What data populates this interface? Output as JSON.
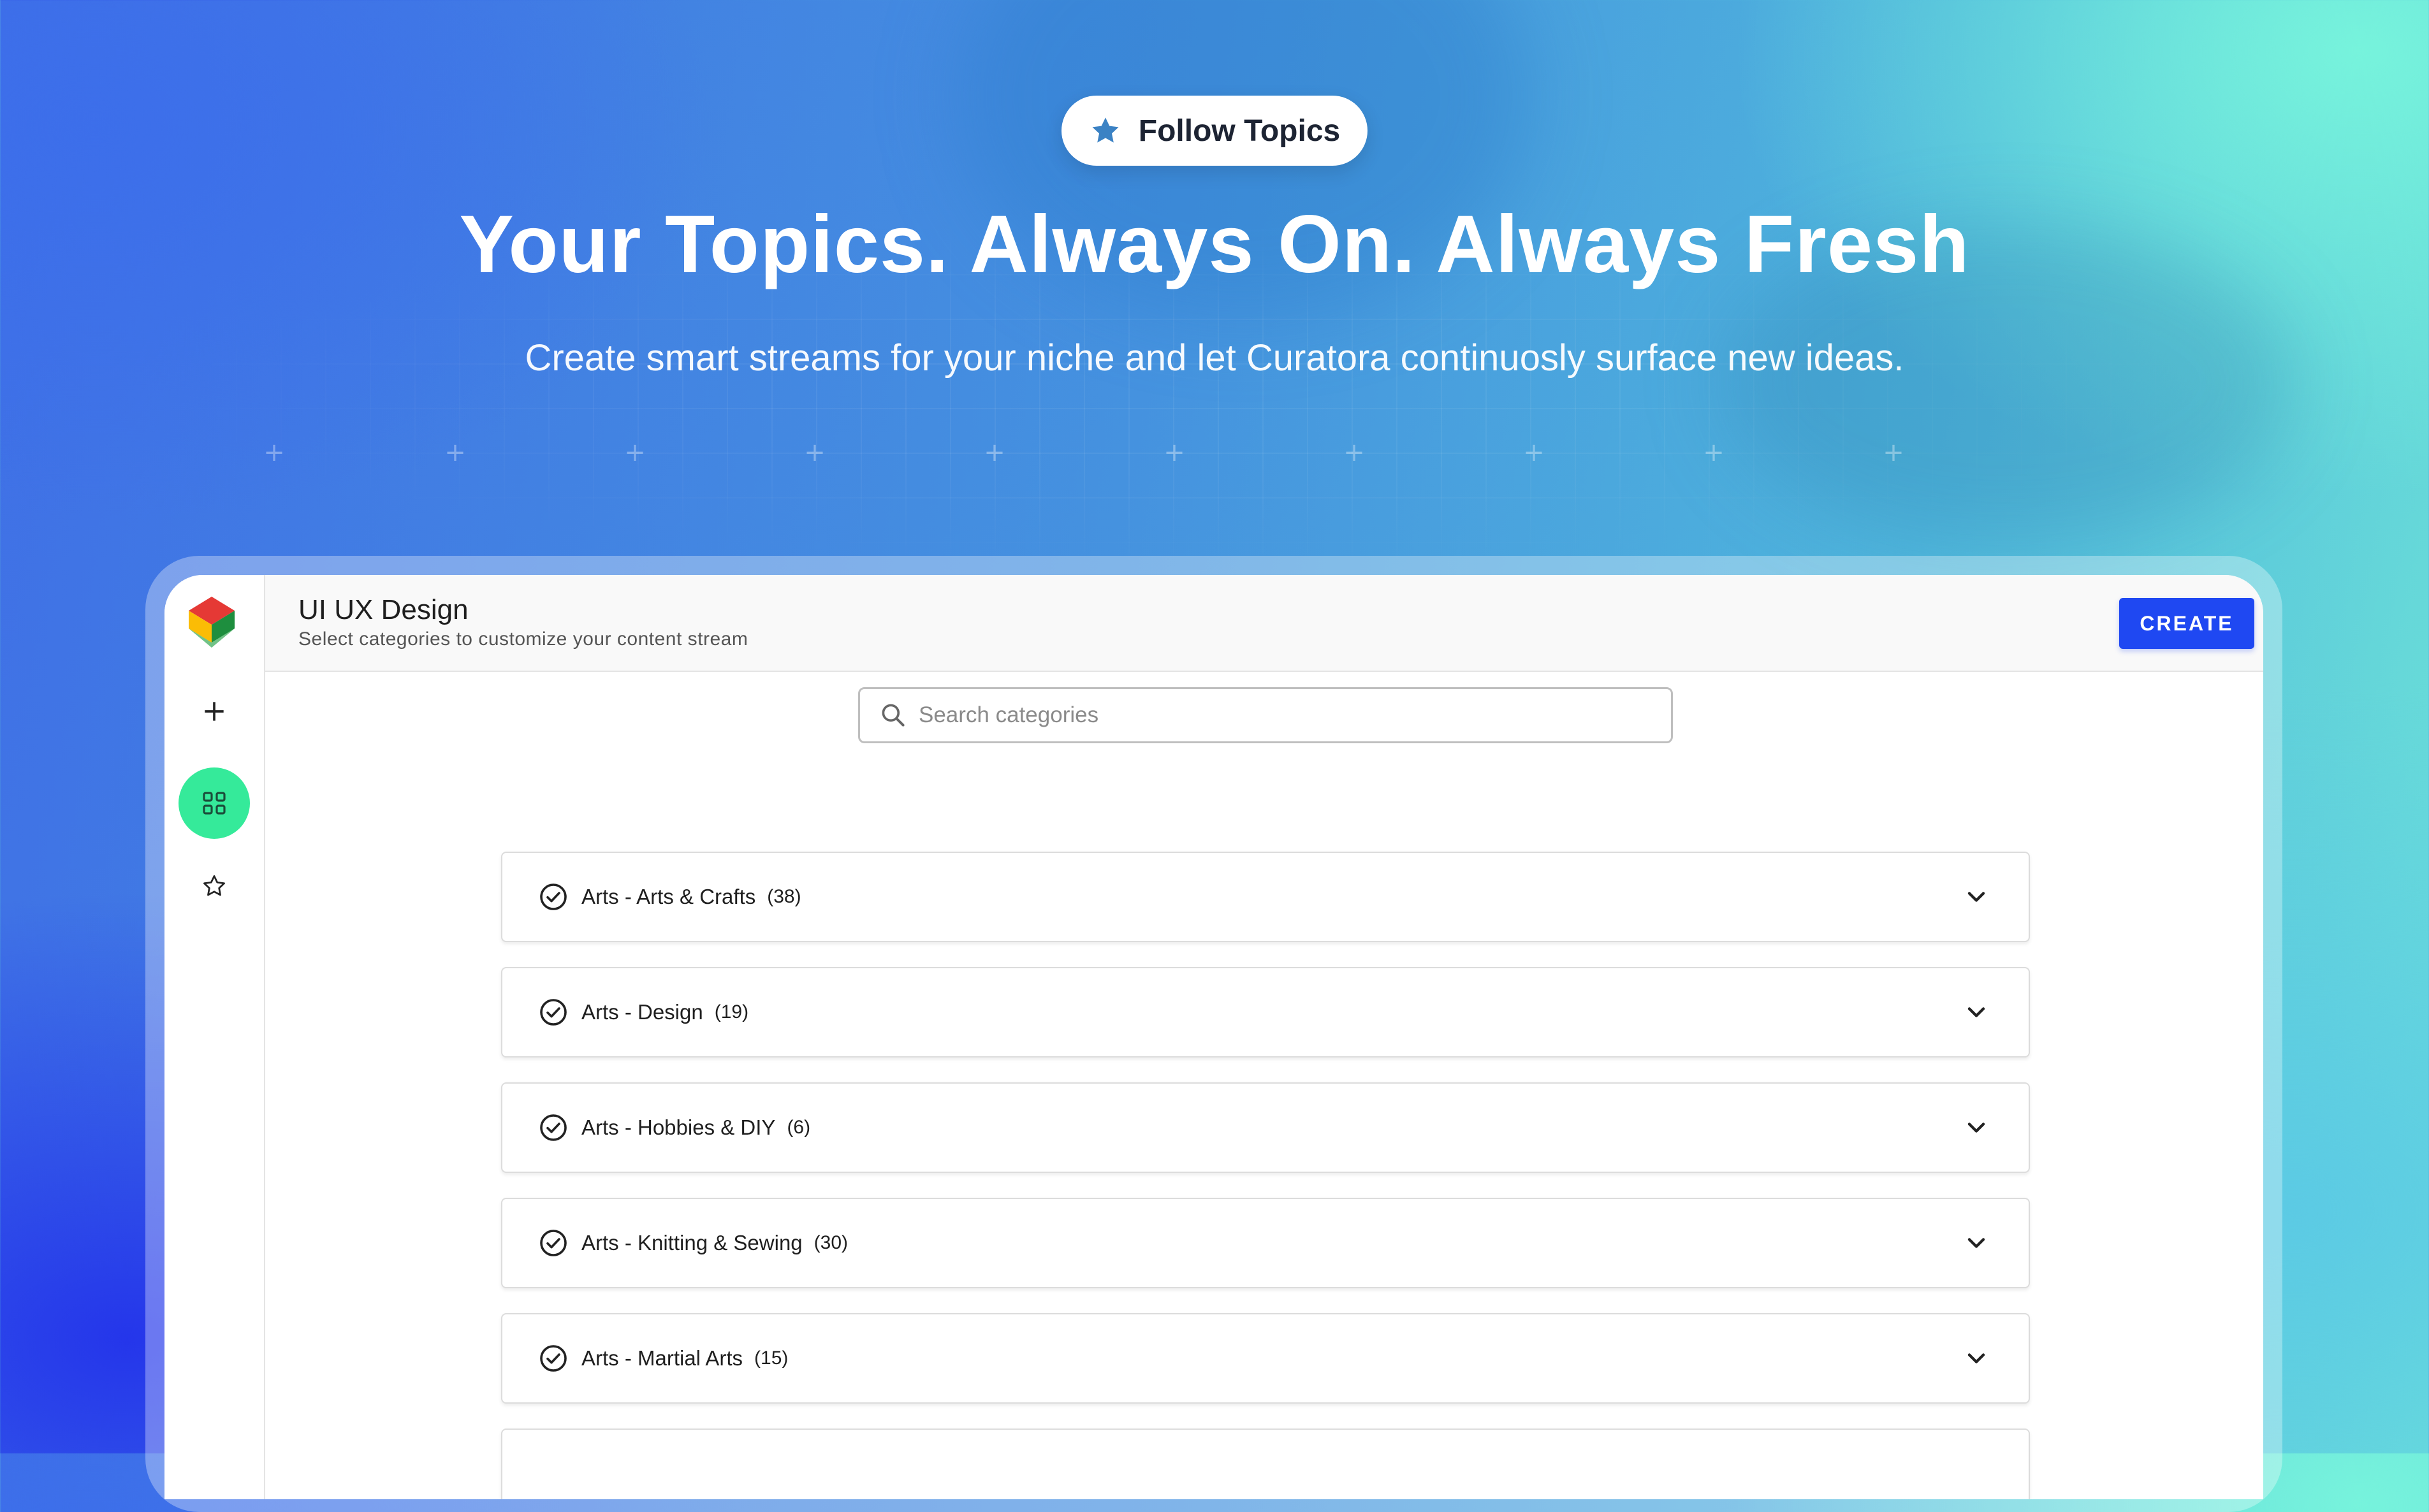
{
  "hero": {
    "pill_label": "Follow Topics",
    "title": "Your Topics. Always On. Always Fresh",
    "subtitle": "Create smart streams for your niche and let Curatora continuosly surface new ideas."
  },
  "app": {
    "sidebar": {
      "items": [
        {
          "name": "add",
          "icon": "plus-icon"
        },
        {
          "name": "categories",
          "icon": "grid-icon",
          "active": true
        },
        {
          "name": "favorites",
          "icon": "star-icon"
        }
      ]
    },
    "header": {
      "title": "UI UX Design",
      "subtitle": "Select categories to customize your content stream",
      "create_label": "CREATE"
    },
    "search": {
      "placeholder": "Search categories"
    },
    "categories": [
      {
        "name": "Arts - Arts & Crafts",
        "count": "(38)"
      },
      {
        "name": "Arts - Design",
        "count": "(19)"
      },
      {
        "name": "Arts - Hobbies & DIY",
        "count": "(6)"
      },
      {
        "name": "Arts - Knitting & Sewing",
        "count": "(30)"
      },
      {
        "name": "Arts - Martial Arts",
        "count": "(15)"
      }
    ]
  },
  "colors": {
    "accent": "#1f48f2",
    "active_nav": "#35ea9a",
    "pill_star": "#3b82c4"
  }
}
